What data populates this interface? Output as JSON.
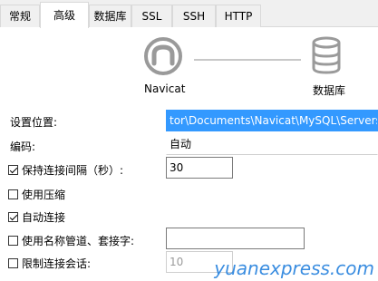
{
  "tabs": [
    {
      "label": "常规",
      "active": false
    },
    {
      "label": "高级",
      "active": true
    },
    {
      "label": "数据库",
      "active": false
    },
    {
      "label": "SSL",
      "active": false
    },
    {
      "label": "SSH",
      "active": false
    },
    {
      "label": "HTTP",
      "active": false
    }
  ],
  "diagram": {
    "left_label": "Navicat",
    "right_label": "数据库"
  },
  "form": {
    "settings_location_label": "设置位置:",
    "settings_location_value": "tor\\Documents\\Navicat\\MySQL\\Servers\\",
    "encoding_label": "编码:",
    "encoding_value": "自动",
    "keepalive_label": "保持连接间隔（秒）:",
    "keepalive_value": "30",
    "keepalive_checked": true,
    "compression_label": "使用压缩",
    "compression_checked": false,
    "autoconnect_label": "自动连接",
    "autoconnect_checked": true,
    "namedpipe_label": "使用名称管道、套接字:",
    "namedpipe_checked": false,
    "namedpipe_value": "",
    "limit_session_label": "限制连接会话:",
    "limit_session_checked": false,
    "limit_session_value": "10"
  },
  "watermark": "yuanexpress.com",
  "colors": {
    "selection": "#3399ff",
    "watermark": "#3a8de0",
    "icon_gray": "#9a9a9a"
  }
}
